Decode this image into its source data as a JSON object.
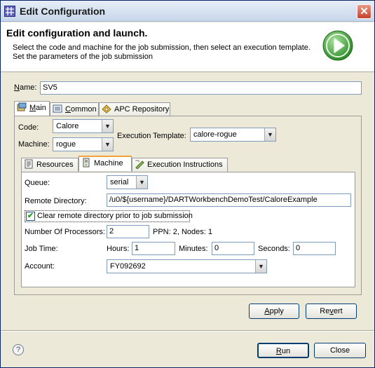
{
  "window": {
    "title": "Edit Configuration",
    "close_glyph": "✕",
    "close_icon": "close-icon",
    "app_icon": "grid-app-icon"
  },
  "header": {
    "title": "Edit configuration and launch.",
    "description_line1": "Select the code and machine for the job submission, then select an execution template.",
    "description_line2": "Set the parameters of the job submission",
    "graphic": "run-play-graphic"
  },
  "name_field": {
    "label_u": "N",
    "label_rest": "ame:",
    "value": "SV5"
  },
  "main_tabs": [
    {
      "label_pre": "",
      "label_u": "M",
      "label_rest": "ain",
      "icon": "main-icon"
    },
    {
      "label_pre": "",
      "label_u": "C",
      "label_rest": "ommon",
      "icon": "common-icon"
    },
    {
      "label_pre": "APC Repository",
      "label_u": "",
      "label_rest": "",
      "icon": "repository-icon"
    }
  ],
  "main": {
    "code_label": "Code:",
    "code_value": "Calore",
    "machine_label": "Machine:",
    "machine_value": "rogue",
    "template_label": "Execution Template:",
    "template_value": "calore-rogue",
    "dropdown_glyph": "▼"
  },
  "sub_tabs": [
    {
      "label": "Resources",
      "icon": "resources-icon"
    },
    {
      "label": "Machine",
      "icon": "machine-icon"
    },
    {
      "label": "Execution Instructions",
      "icon": "instructions-icon"
    }
  ],
  "machine": {
    "queue_label": "Queue:",
    "queue_value": "serial",
    "remote_dir_label": "Remote Directory:",
    "remote_dir_value": "/u0/${username}/DARTWorkbenchDemoTest/CaloreExample",
    "clear_checkbox_label": "Clear remote directory prior to job submission",
    "clear_checked": true,
    "check_glyph": "✔",
    "processors_label": "Number Of Processors:",
    "processors_value": "2",
    "ppn_text": "PPN: 2, Nodes: 1",
    "job_time_label": "Job Time:",
    "hours_label": "Hours:",
    "hours_value": "1",
    "minutes_label": "Minutes:",
    "minutes_value": "0",
    "seconds_label": "Seconds:",
    "seconds_value": "0",
    "account_label": "Account:",
    "account_value": "FY092692"
  },
  "buttons": {
    "apply_u": "A",
    "apply_pre": "",
    "apply_rest": "pply",
    "revert_pre": "Re",
    "revert_u": "v",
    "revert_rest": "ert",
    "run_pre": "",
    "run_u": "R",
    "run_rest": "un",
    "close": "Close",
    "help_glyph": "?"
  },
  "colors": {
    "accent": "#f0a33a",
    "run_green": "#3fa33a",
    "border_blue": "#7f9db9"
  }
}
